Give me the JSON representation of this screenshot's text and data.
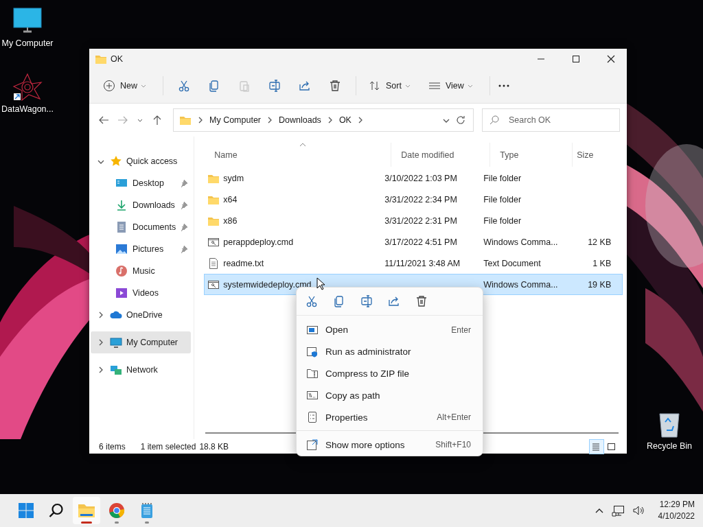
{
  "desktop_icons": [
    {
      "label": "My Computer",
      "kind": "computer"
    },
    {
      "label": "DataWagon...",
      "kind": "app"
    },
    {
      "label": "Recycle Bin",
      "kind": "recycle"
    }
  ],
  "window": {
    "title": "OK",
    "toolbar": {
      "new_button": "New",
      "actions": [
        {
          "kind": "cut",
          "disabled": false
        },
        {
          "kind": "copy",
          "disabled": false
        },
        {
          "kind": "paste",
          "disabled": true
        },
        {
          "kind": "rename",
          "disabled": false
        },
        {
          "kind": "share",
          "disabled": false
        },
        {
          "kind": "delete",
          "disabled": false
        }
      ],
      "sort_button": "Sort",
      "view_button": "View"
    },
    "address": {
      "breadcrumbs": [
        "My Computer",
        "Downloads",
        "OK"
      ]
    },
    "search": {
      "placeholder": "Search OK"
    },
    "sidebar": {
      "items": [
        {
          "label": "Quick access",
          "kind": "star",
          "expanded": true,
          "selected": false,
          "children": [
            {
              "label": "Desktop",
              "kind": "desktop",
              "pinned": true,
              "selected": false
            },
            {
              "label": "Downloads",
              "kind": "download",
              "pinned": true,
              "selected": false
            },
            {
              "label": "Documents",
              "kind": "documents",
              "pinned": true,
              "selected": false
            },
            {
              "label": "Pictures",
              "kind": "pictures",
              "pinned": true,
              "selected": false
            },
            {
              "label": "Music",
              "kind": "music",
              "pinned": false,
              "selected": false
            },
            {
              "label": "Videos",
              "kind": "videos",
              "pinned": false,
              "selected": false
            }
          ]
        },
        {
          "label": "OneDrive",
          "kind": "cloud",
          "expanded": false,
          "selected": false
        },
        {
          "label": "My Computer",
          "kind": "computer",
          "expanded": false,
          "selected": true
        },
        {
          "label": "Network",
          "kind": "network",
          "expanded": false,
          "selected": false
        }
      ]
    },
    "table": {
      "columns": [
        "Name",
        "Date modified",
        "Type",
        "Size"
      ],
      "rows": [
        {
          "name": "sydm",
          "kind": "folder",
          "date": "3/10/2022 1:03 PM",
          "type": "File folder",
          "size": "",
          "selected": false
        },
        {
          "name": "x64",
          "kind": "folder",
          "date": "3/31/2022 2:34 PM",
          "type": "File folder",
          "size": "",
          "selected": false
        },
        {
          "name": "x86",
          "kind": "folder",
          "date": "3/31/2022 2:31 PM",
          "type": "File folder",
          "size": "",
          "selected": false
        },
        {
          "name": "perappdeploy.cmd",
          "kind": "cmd",
          "date": "3/17/2022 4:51 PM",
          "type": "Windows Comma...",
          "size": "12 KB",
          "selected": false
        },
        {
          "name": "readme.txt",
          "kind": "txt",
          "date": "11/11/2021 3:48 AM",
          "type": "Text Document",
          "size": "1 KB",
          "selected": false
        },
        {
          "name": "systemwidedeploy.cmd",
          "kind": "cmd",
          "type": "Windows Comma...",
          "size": "19 KB",
          "selected": true
        }
      ]
    },
    "status_bar": {
      "item_count": "6 items",
      "selection": "1 item selected",
      "selection_size": "18.8 KB",
      "views": [
        {
          "kind": "details",
          "selected": true
        },
        {
          "kind": "tiles",
          "selected": false
        }
      ]
    }
  },
  "context_menu": {
    "quick_actions": [
      {
        "kind": "cut"
      },
      {
        "kind": "copy"
      },
      {
        "kind": "rename"
      },
      {
        "kind": "share"
      },
      {
        "kind": "delete"
      }
    ],
    "items": [
      {
        "label": "Open",
        "shortcut": "Enter",
        "kind": "open"
      },
      {
        "label": "Run as administrator",
        "kind": "admin"
      },
      {
        "label": "Compress to ZIP file",
        "kind": "zip"
      },
      {
        "label": "Copy as path",
        "kind": "path"
      },
      {
        "label": "Properties",
        "shortcut": "Alt+Enter",
        "kind": "properties"
      },
      {
        "label": "Show more options",
        "shortcut": "Shift+F10",
        "kind": "more",
        "separated": true
      }
    ]
  },
  "taskbar": {
    "apps": [
      {
        "kind": "start"
      },
      {
        "kind": "search"
      },
      {
        "kind": "explorer",
        "running": true,
        "active": true
      },
      {
        "kind": "browser",
        "running": true,
        "active": false
      },
      {
        "kind": "notepad",
        "running": true,
        "active": false
      }
    ],
    "time": "12:29 PM",
    "date": "4/10/2022"
  }
}
